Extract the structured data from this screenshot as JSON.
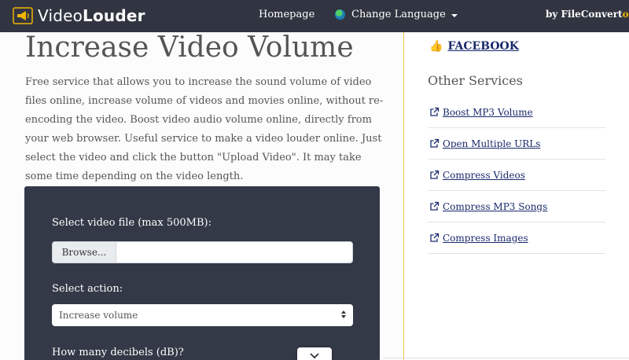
{
  "navbar": {
    "brand_prefix": "Video",
    "brand_bold": "Louder",
    "homepage": "Homepage",
    "change_language": "Change Language",
    "by_prefix": "by FileConvert",
    "by_accent": "o"
  },
  "main": {
    "title": "Increase Video Volume",
    "intro": "Free service that allows you to increase the sound volume of video files online, increase volume of videos and movies online, without re-encoding the video. Boost video audio volume online, directly from your web browser. Useful service to make a video louder online. Just select the video and click the button \"Upload Video\". It may take some time depending on the video length.",
    "form": {
      "file_label": "Select video file (max 500MB):",
      "browse": "Browse...",
      "action_label": "Select action:",
      "action_value": "Increase volume",
      "db_label": "How many decibels (dB)?"
    }
  },
  "sidebar": {
    "facebook": "FACEBOOK",
    "other_services_title": "Other Services",
    "services": [
      {
        "label": " Boost MP3 Volume"
      },
      {
        "label": " Open Multiple URLs"
      },
      {
        "label": " Compress Videos"
      },
      {
        "label": " Compress MP3 Songs"
      },
      {
        "label": " Compress Images"
      }
    ]
  },
  "colors": {
    "navbar_bg": "#313541",
    "form_bg": "#343947",
    "accent": "#f0b400",
    "link": "#1a2a6c"
  },
  "icons": {
    "brand": "megaphone-icon",
    "language": "globe-icon",
    "facebook": "thumbs-up-icon",
    "service": "external-link-icon"
  }
}
